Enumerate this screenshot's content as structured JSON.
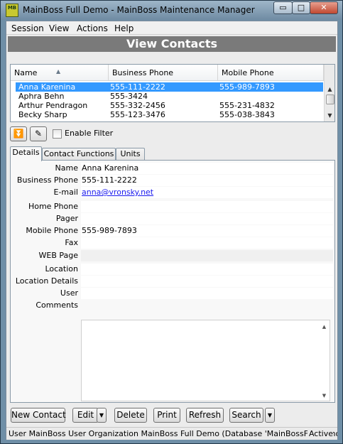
{
  "window": {
    "title": "MainBoss Full Demo - MainBoss Maintenance Manager",
    "app_icon_label": "MB",
    "minimize_glyph": "▭",
    "maximize_glyph": "□",
    "close_glyph": "✕"
  },
  "menu": {
    "items": [
      "Session",
      "View",
      "Actions",
      "Help"
    ]
  },
  "header": {
    "title": "View Contacts"
  },
  "grid": {
    "columns": [
      "Name",
      "Business Phone",
      "Mobile Phone"
    ],
    "rows": [
      {
        "name": "Anna Karenina",
        "business_phone": "555-111-2222",
        "mobile_phone": "555-989-7893",
        "selected": true
      },
      {
        "name": "Aphra Behn",
        "business_phone": "555-3424",
        "mobile_phone": "",
        "selected": false
      },
      {
        "name": "Arthur Pendragon",
        "business_phone": "555-332-2456",
        "mobile_phone": "555-231-4832",
        "selected": false
      },
      {
        "name": "Becky Sharp",
        "business_phone": "555-123-3476",
        "mobile_phone": "555-038-3843",
        "selected": false
      }
    ]
  },
  "toolbar": {
    "collapse_icon": "collapse-icon",
    "filter_edit_icon": "filter-edit-icon",
    "enable_filter_label": "Enable Filter",
    "enable_filter_checked": false
  },
  "tabs": [
    {
      "label": "Details",
      "active": true
    },
    {
      "label": "Contact Functions",
      "active": false
    },
    {
      "label": "Units",
      "active": false
    }
  ],
  "details": {
    "fields": [
      {
        "label": "Name",
        "value": "Anna Karenina",
        "shaded": true
      },
      {
        "label": "Business Phone",
        "value": "555-111-2222",
        "shaded": true
      },
      {
        "label": "E-mail",
        "value": "anna@vronsky.net",
        "shaded": true,
        "link": true
      },
      {
        "label": "Home Phone",
        "value": "",
        "shaded": false
      },
      {
        "label": "Pager",
        "value": "",
        "shaded": false
      },
      {
        "label": "Mobile Phone",
        "value": "555-989-7893",
        "shaded": true
      },
      {
        "label": "Fax",
        "value": "",
        "shaded": false
      },
      {
        "label": "WEB Page",
        "value": "",
        "shaded": true
      },
      {
        "label": "Location",
        "value": "",
        "shaded": false
      },
      {
        "label": "Location Details",
        "value": "",
        "shaded": false
      },
      {
        "label": "User",
        "value": "",
        "shaded": false
      }
    ],
    "comments_label": "Comments",
    "comments_value": ""
  },
  "buttons": {
    "new_contact": "New Contact",
    "edit": "Edit",
    "delete": "Delete",
    "print": "Print",
    "refresh": "Refresh",
    "search": "Search"
  },
  "status": {
    "text": "User MainBoss User Organization MainBoss Full Demo (Database 'MainBossFullDemo' on",
    "state": "Active"
  },
  "colors": {
    "selection": "#3399ff",
    "header_bar": "#7a7a7a",
    "link": "#1a1aee"
  }
}
